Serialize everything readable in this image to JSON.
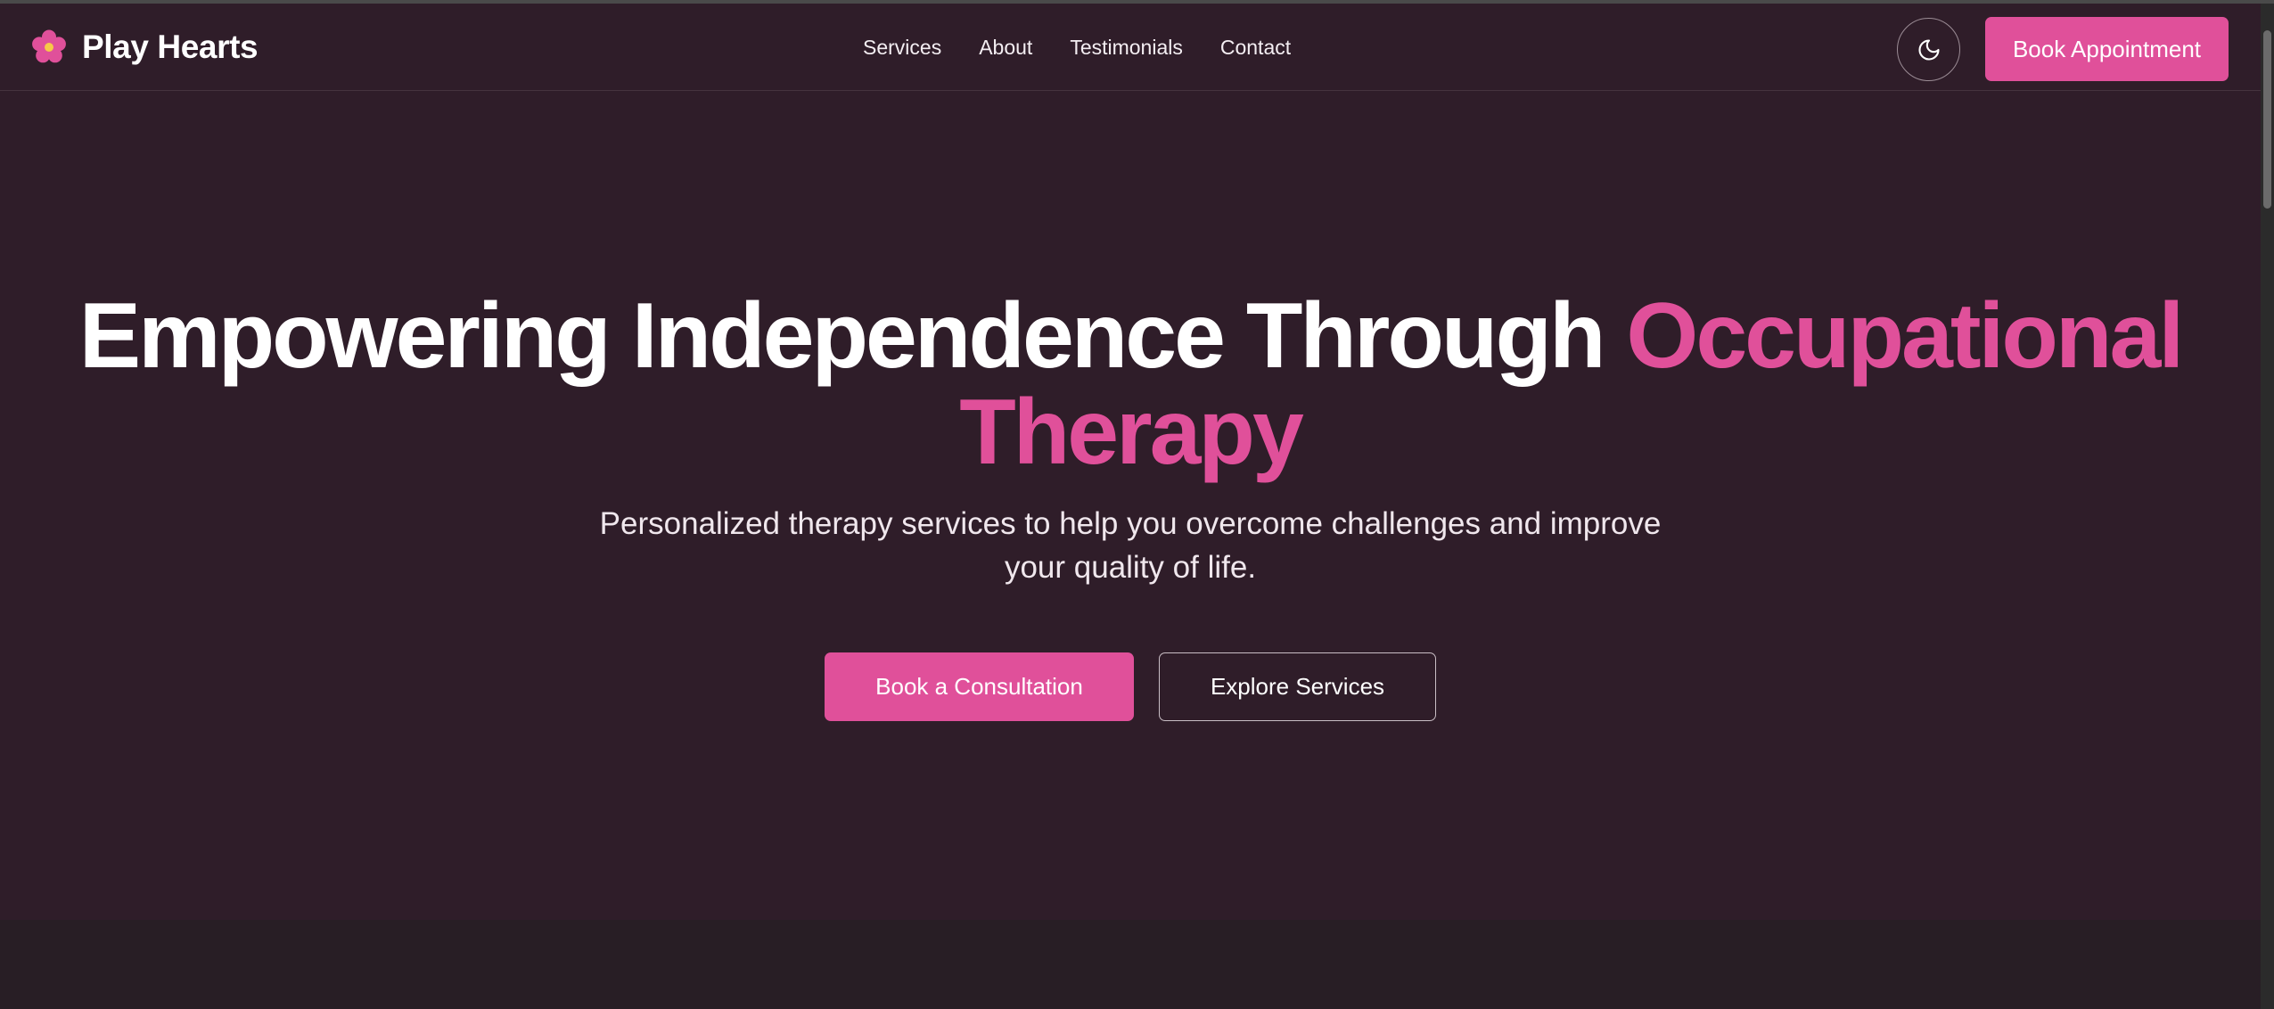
{
  "brand": {
    "name": "Play Hearts",
    "icon": "flower-icon"
  },
  "nav": {
    "items": [
      {
        "label": "Services"
      },
      {
        "label": "About"
      },
      {
        "label": "Testimonials"
      },
      {
        "label": "Contact"
      }
    ]
  },
  "header": {
    "theme_toggle_icon": "moon-icon",
    "book_label": "Book Appointment"
  },
  "hero": {
    "title_main": "Empowering Independence Through",
    "title_accent": "Occupational Therapy",
    "subtitle": "Personalized therapy services to help you overcome challenges and improve your quality of life.",
    "primary_cta": "Book a Consultation",
    "secondary_cta": "Explore Services"
  },
  "colors": {
    "background": "#2f1d29",
    "accent": "#e0509a",
    "next_section": "#281e25"
  }
}
